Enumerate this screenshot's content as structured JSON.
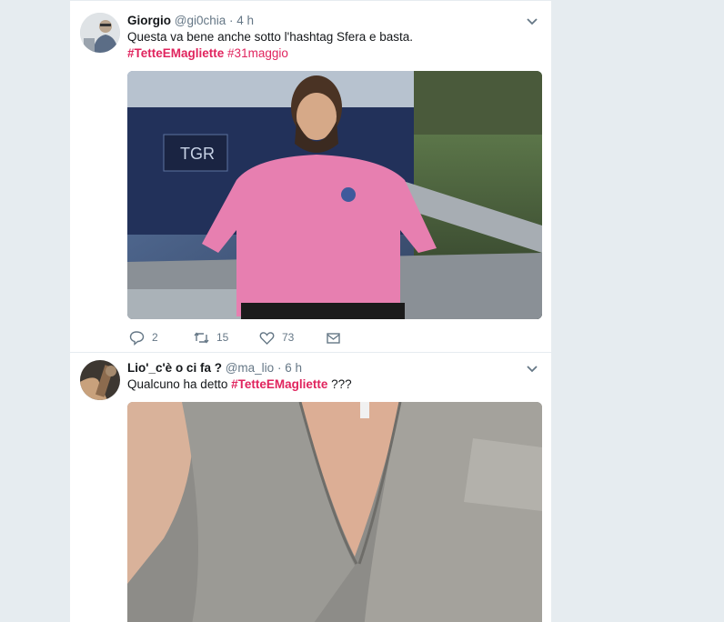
{
  "tweets": [
    {
      "fullname": "Giorgio",
      "handle": "@gi0chia",
      "separator": "·",
      "time": "4 h",
      "text": "Questa va bene anche sotto l'hashtag Sfera e basta.",
      "hashtags": [
        "#TetteEMagliette",
        "#31maggio"
      ],
      "media_description": "Photo of a bearded man in a pink polo shirt sitting in a TV studio with a TGR sign",
      "actions": {
        "replies": "2",
        "retweets": "15",
        "likes": "73"
      }
    },
    {
      "fullname": "Lio'_c'è o ci fa ?",
      "handle": "@ma_lio",
      "separator": "·",
      "time": "6 h",
      "text_before": "Qualcuno ha detto ",
      "hashtag": "#TetteEMagliette",
      "text_after": " ???",
      "media_description": "Close-up photo of a grey open shirt neckline"
    }
  ],
  "studio_sign": "TGR",
  "colors": {
    "background": "#e6ecf0",
    "card": "#ffffff",
    "hashtag": "#e0245e",
    "secondary_text": "#657786",
    "pink_shirt": "#e77fb0"
  }
}
